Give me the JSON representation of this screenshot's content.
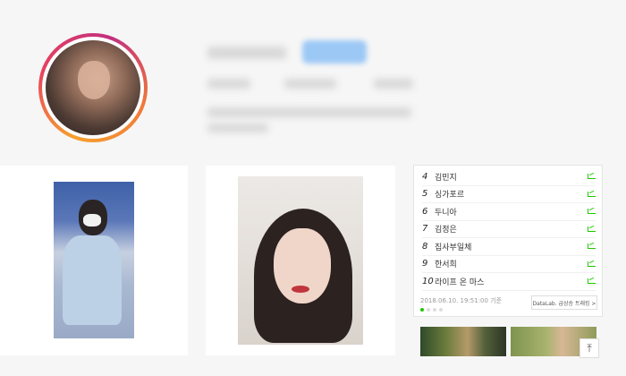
{
  "ranking": {
    "items": [
      {
        "rank": "4",
        "keyword": "김민지"
      },
      {
        "rank": "5",
        "keyword": "싱가포르"
      },
      {
        "rank": "6",
        "keyword": "두니아"
      },
      {
        "rank": "7",
        "keyword": "김정은"
      },
      {
        "rank": "8",
        "keyword": "집사부일체"
      },
      {
        "rank": "9",
        "keyword": "한서희"
      },
      {
        "rank": "10",
        "keyword": "라이프 온 마스"
      }
    ],
    "date": "2018.06.10. 19:51:00 기준",
    "datalab_label": "DataLab. 급상승 트래킹 >",
    "trend_icon": "trend-chart-icon",
    "accent_color": "#1ec800"
  },
  "scroll_top_icon": "arrow-to-top-icon",
  "scroll_top_glyph": "⤒"
}
